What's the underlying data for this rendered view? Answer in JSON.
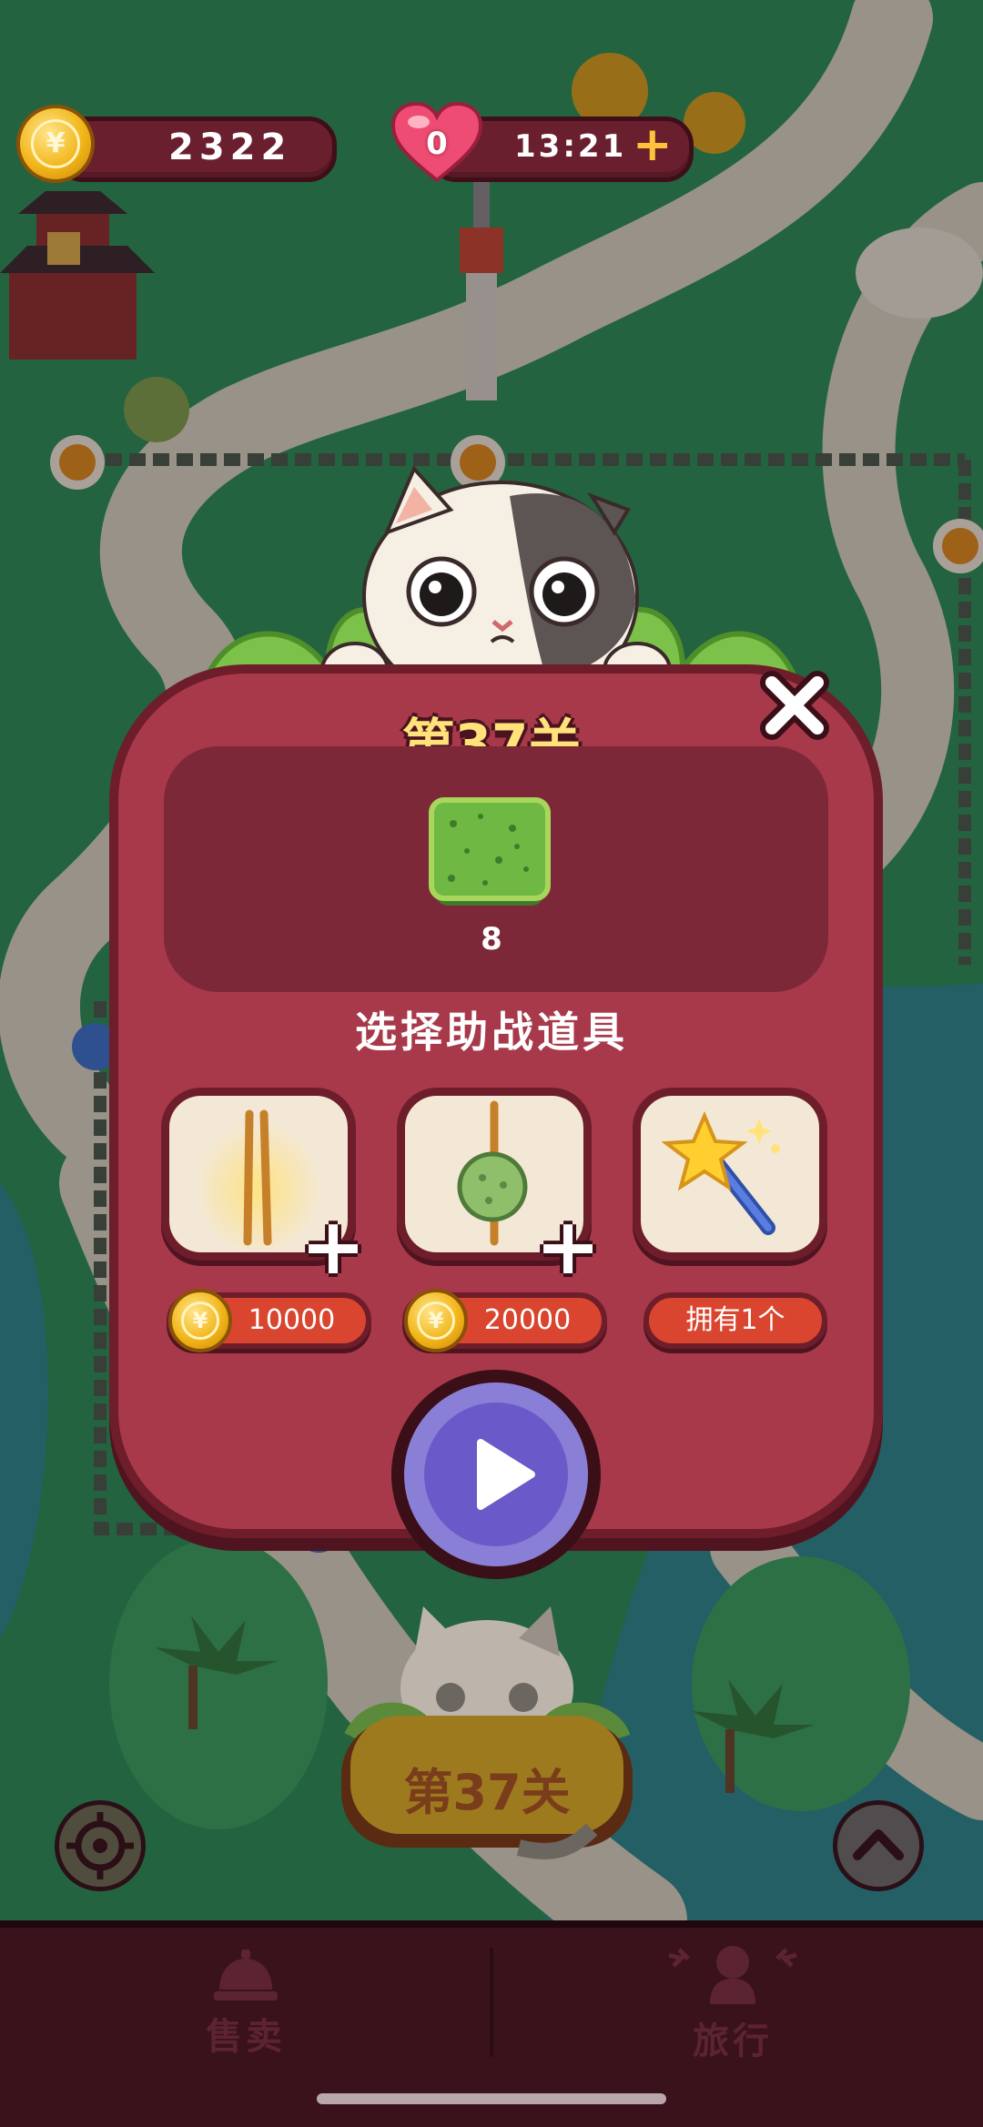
{
  "hud": {
    "coins": "2322",
    "coin_symbol": "¥",
    "lives": "0",
    "life_timer": "13:21",
    "add_label": "+"
  },
  "dialog": {
    "title": "第37关",
    "goal_count": "8",
    "booster_header": "选择助战道具",
    "boosters": [
      {
        "icon": "chopstick-icon",
        "price": "10000"
      },
      {
        "icon": "skewer-icon",
        "price": "20000"
      },
      {
        "icon": "magic-wand-icon",
        "owned_label": "拥有1个"
      }
    ],
    "close_label": "✕"
  },
  "map": {
    "level_banner": "第37关"
  },
  "bottom_nav": {
    "items": [
      {
        "label": "售卖",
        "icon": "service-bell-icon"
      },
      {
        "label": "旅行",
        "icon": "traveler-icon"
      }
    ]
  },
  "colors": {
    "dialog": "#a8394a",
    "dialog_border": "#6e1d2b",
    "price_button": "#d9452f",
    "play_button": "#6a59c8",
    "title_text": "#ffe27a"
  }
}
